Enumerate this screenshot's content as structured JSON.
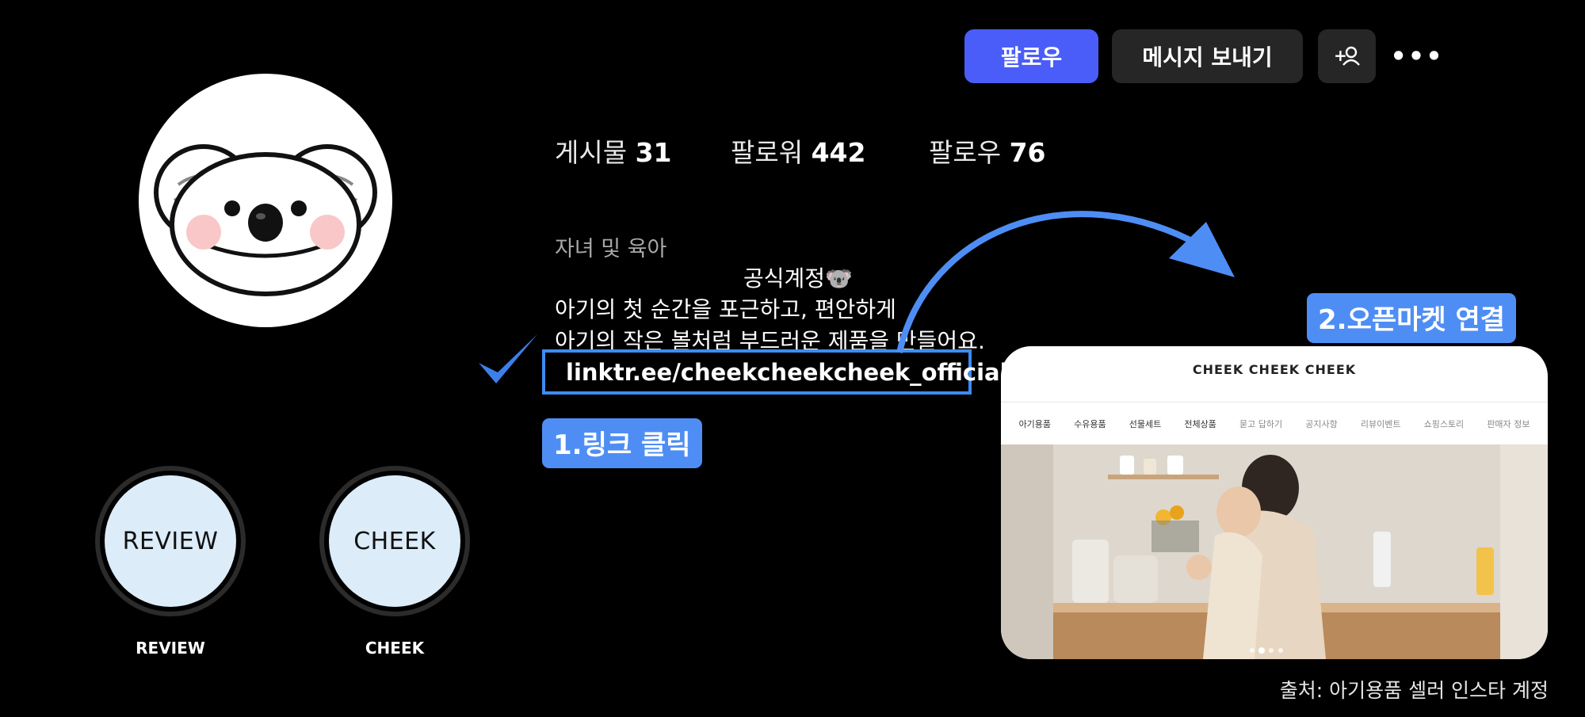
{
  "profile": {
    "avatar_icon": "koala-icon",
    "stats": [
      {
        "label": "게시물",
        "value": "31"
      },
      {
        "label": "팔로워",
        "value": "442"
      },
      {
        "label": "팔로우",
        "value": "76"
      }
    ],
    "category": "자녀 및 육아",
    "bio": {
      "line1": "공식계정🐨",
      "line2": "아기의 첫 순간을 포근하고, 편안하게",
      "line3": "아기의 작은 볼처럼 부드러운 제품을 만들어요."
    },
    "link": "linktr.ee/cheekcheekcheek_official"
  },
  "actions": {
    "follow": "팔로우",
    "message": "메시지 보내기",
    "add_person": "+",
    "more": "•••"
  },
  "highlights": [
    {
      "cover": "REVIEW",
      "label": "REVIEW"
    },
    {
      "cover": "CHEEK",
      "label": "CHEEK"
    }
  ],
  "annotations": {
    "step1": "1.링크 클릭",
    "step2": "2.오픈마켓 연결",
    "accent_color": "#4e8ef4"
  },
  "shop": {
    "logo": "CHEEK CHEEK CHEEK",
    "nav": [
      "아기용품",
      "수유용품",
      "선물세트",
      "전체상품",
      "묻고 답하기",
      "공지사항",
      "리뷰이벤트",
      "쇼핑스토리",
      "판매자 정보"
    ]
  },
  "source": "출처: 아기용품 셀러 인스타 계정",
  "colors": {
    "follow_button": "#4a5df9",
    "secondary_button": "#262626",
    "highlight_fill": "#dcecf8"
  }
}
